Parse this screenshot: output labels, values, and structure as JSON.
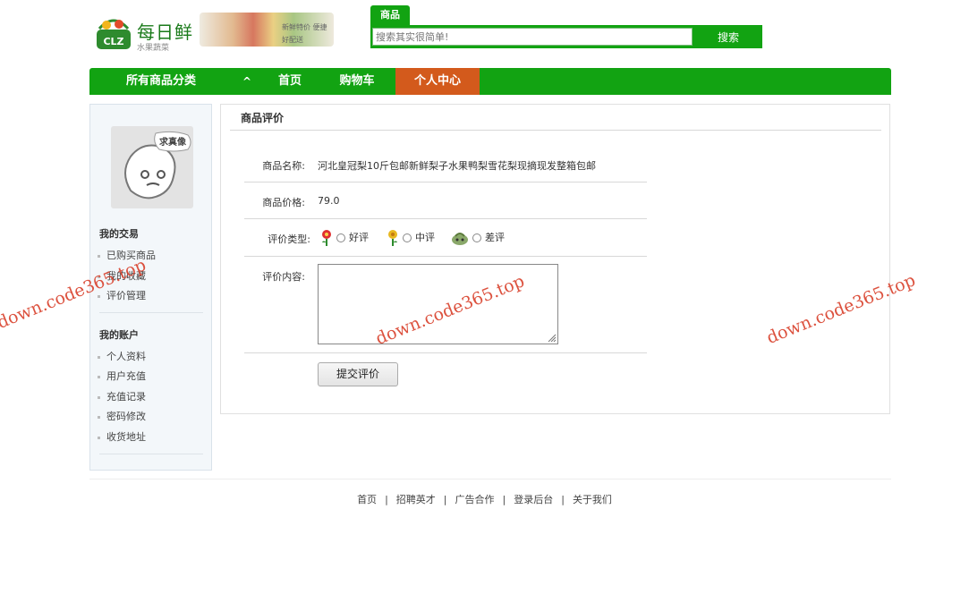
{
  "header": {
    "logo_badge": "CLZ",
    "logo_title": "每日鲜",
    "logo_sub": "水果蔬菜",
    "logo_slogan": "新鲜特价 便捷好配送",
    "search_tab": "商品",
    "search_placeholder": "搜索其实很简单!",
    "search_button": "搜索"
  },
  "nav": {
    "all_categories": "所有商品分类",
    "arrow": "^",
    "home": "首页",
    "cart": "购物车",
    "user_center": "个人中心",
    "active_color": "#d35a1c",
    "bar_color": "#12a312"
  },
  "sidebar": {
    "avatar_bubble": "求真像",
    "trade_heading": "我的交易",
    "trade_items": [
      "已购买商品",
      "我的收藏",
      "评价管理"
    ],
    "account_heading": "我的账户",
    "account_items": [
      "个人资料",
      "用户充值",
      "充值记录",
      "密码修改",
      "收货地址"
    ]
  },
  "review": {
    "title": "商品评价",
    "name_label": "商品名称:",
    "name_value": "河北皇冠梨10斤包邮新鲜梨子水果鸭梨雪花梨现摘现发整箱包邮",
    "price_label": "商品价格:",
    "price_value": "79.0",
    "type_label": "评价类型:",
    "options": [
      "好评",
      "中评",
      "差评"
    ],
    "content_label": "评价内容:",
    "content_value": "",
    "submit": "提交评价"
  },
  "footer": {
    "links": [
      "首页",
      "招聘英才",
      "广告合作",
      "登录后台",
      "关于我们"
    ],
    "separator": "|"
  },
  "watermark": "down.code365.top"
}
